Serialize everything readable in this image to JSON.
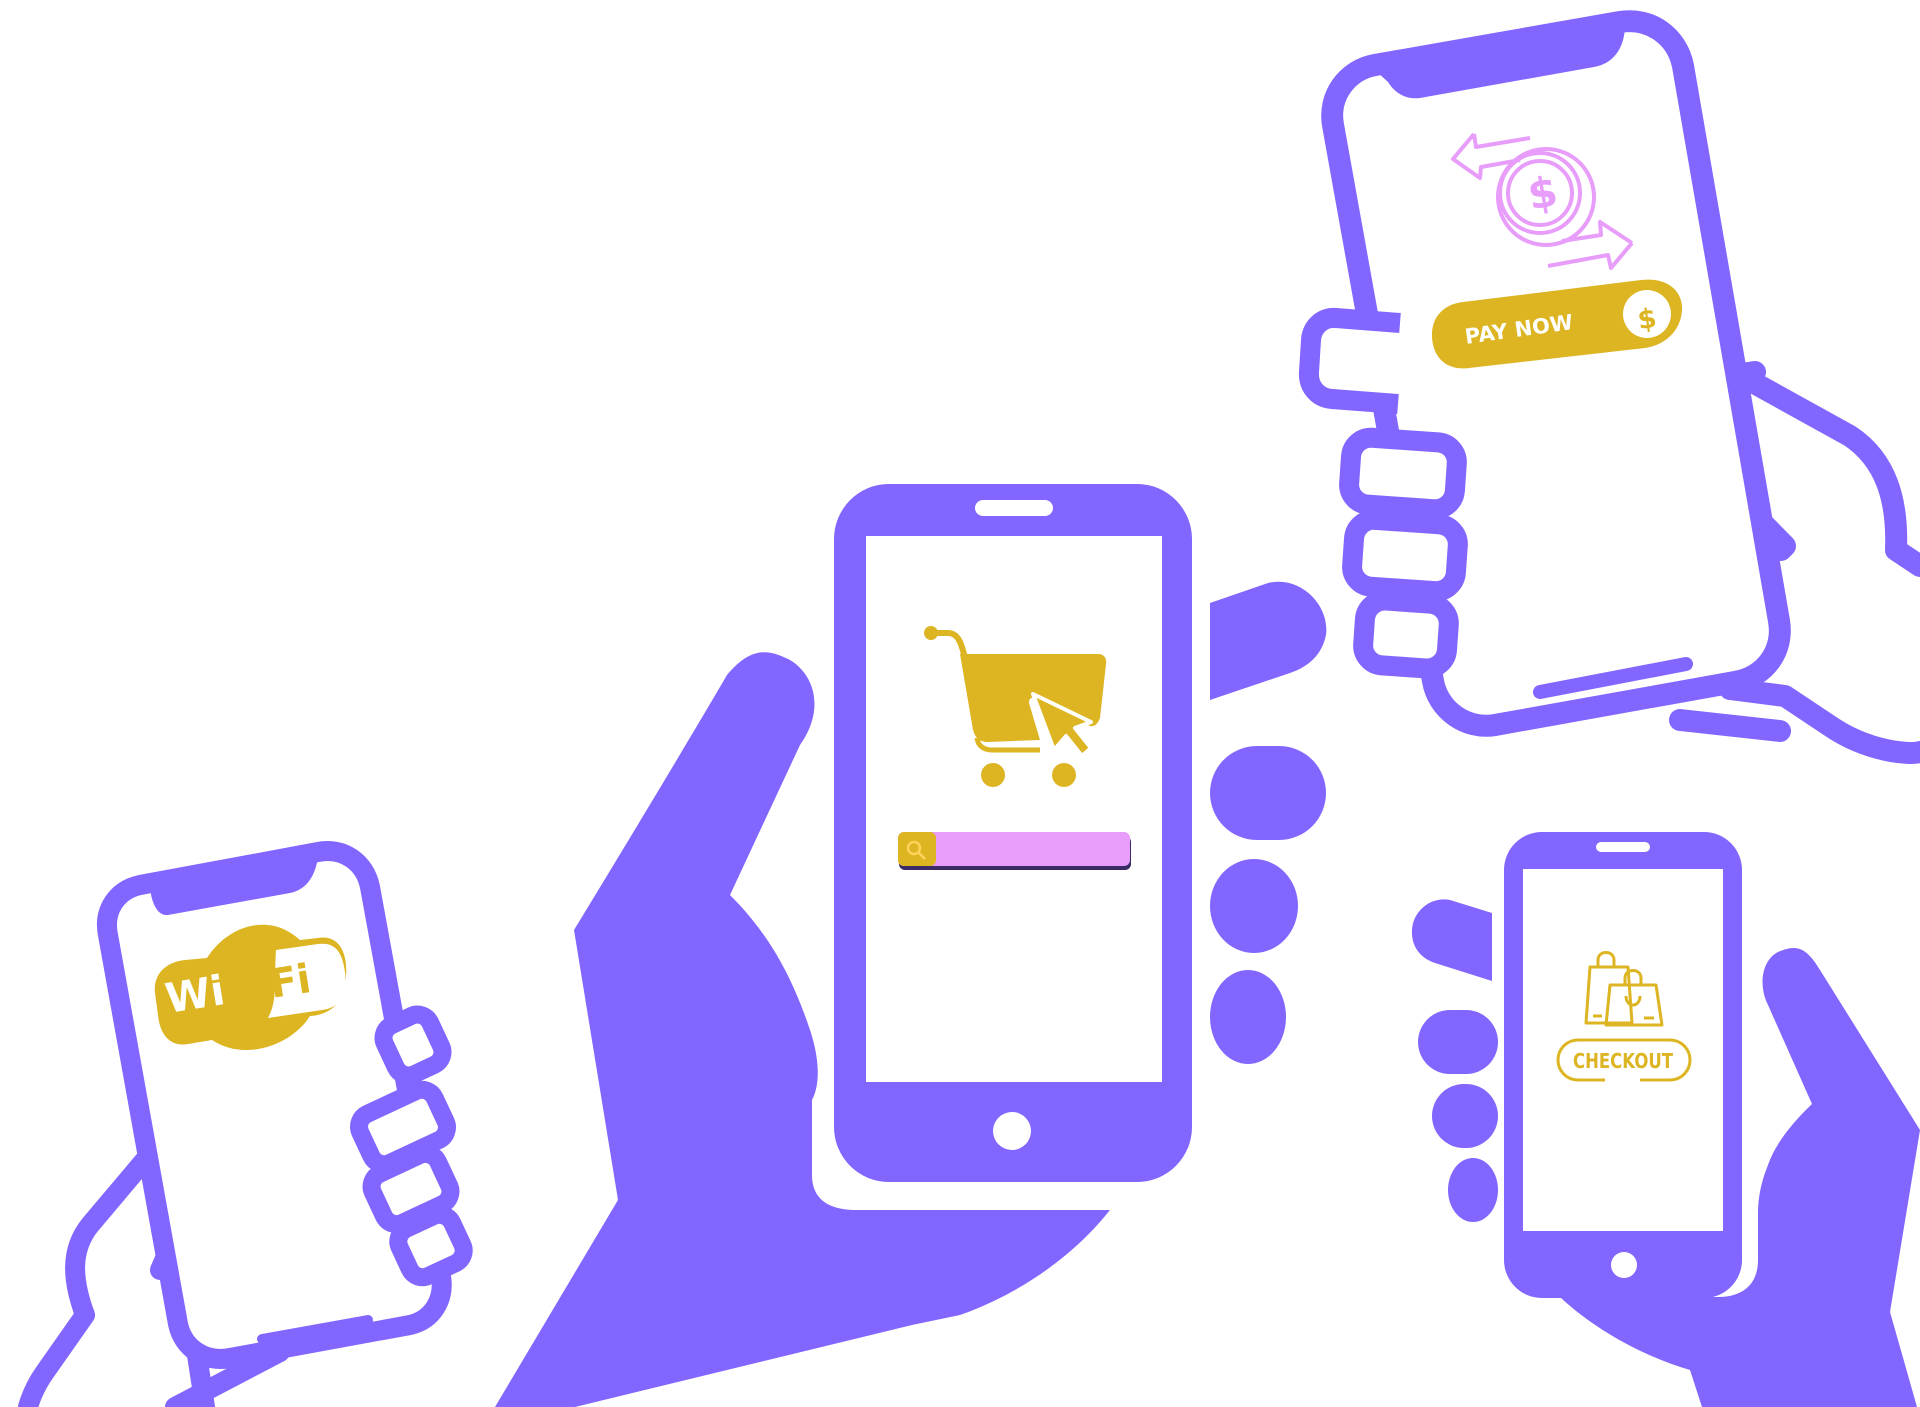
{
  "wifi": {
    "word1": "Wi",
    "word2": "Fi"
  },
  "payment": {
    "button_label": "PAY NOW",
    "coin_symbol": "$"
  },
  "checkout": {
    "label": "CHECKOUT"
  },
  "colors": {
    "primary": "#8266FF",
    "accent": "#DDB522",
    "pink": "#E79DF9",
    "background": "#FFFFFF"
  },
  "icons": [
    "shopping-cart-icon",
    "cursor-icon",
    "search-icon",
    "dollar-coin-icon",
    "exchange-arrows-icon",
    "shopping-bags-icon",
    "wifi-logo-icon"
  ]
}
